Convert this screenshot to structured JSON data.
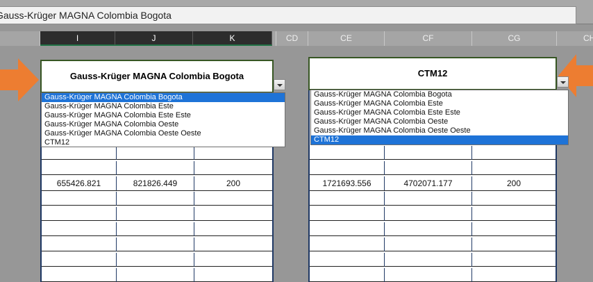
{
  "formula_bar": {
    "value": "Gauss-Krüger MAGNA Colombia Bogota"
  },
  "columns": [
    {
      "label": "I",
      "selected": true
    },
    {
      "label": "J",
      "selected": true
    },
    {
      "label": "K",
      "selected": true
    },
    {
      "label": "CD",
      "selected": false
    },
    {
      "label": "CE",
      "selected": false
    },
    {
      "label": "CF",
      "selected": false
    },
    {
      "label": "CG",
      "selected": false
    },
    {
      "label": "CH",
      "selected": false
    }
  ],
  "left_block": {
    "header": "Gauss-Krüger MAGNA Colombia Bogota",
    "dropdown_options": [
      "Gauss-Krüger MAGNA Colombia Bogota",
      "Gauss-Krüger MAGNA Colombia Este",
      "Gauss-Krüger MAGNA Colombia Este Este",
      "Gauss-Krüger MAGNA Colombia Oeste",
      "Gauss-Krüger MAGNA Colombia Oeste Oeste",
      "CTM12"
    ],
    "selected_option": "Gauss-Krüger MAGNA Colombia Bogota",
    "values": [
      "655426.821",
      "821826.449",
      "200"
    ]
  },
  "right_block": {
    "header": "CTM12",
    "dropdown_options": [
      "Gauss-Krüger MAGNA Colombia Bogota",
      "Gauss-Krüger MAGNA Colombia Este",
      "Gauss-Krüger MAGNA Colombia Este Este",
      "Gauss-Krüger MAGNA Colombia Oeste",
      "Gauss-Krüger MAGNA Colombia Oeste Oeste",
      "CTM12"
    ],
    "selected_option": "CTM12",
    "values": [
      "1721693.556",
      "4702071.177",
      "200"
    ]
  },
  "colors": {
    "arrow": "#ed7d31",
    "selection": "#1e73d7",
    "header_border": "#375623"
  }
}
